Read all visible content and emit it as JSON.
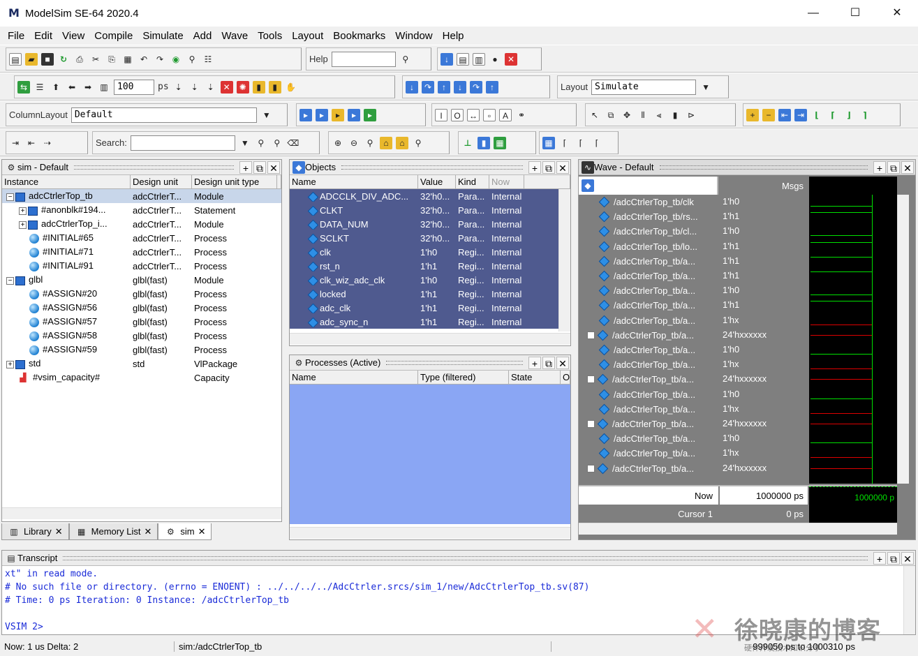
{
  "window": {
    "title": "ModelSim SE-64 2020.4",
    "logo": "M",
    "min": "—",
    "max": "☐",
    "close": "✕"
  },
  "menu": [
    "File",
    "Edit",
    "View",
    "Compile",
    "Simulate",
    "Add",
    "Wave",
    "Tools",
    "Layout",
    "Bookmarks",
    "Window",
    "Help"
  ],
  "toolbar": {
    "help_label": "Help",
    "run_length": "100",
    "run_unit": "ps",
    "layout_label": "Layout",
    "layout_value": "Simulate",
    "columnlayout_label": "ColumnLayout",
    "columnlayout_value": "Default",
    "search_label": "Search:"
  },
  "sim": {
    "title": "sim - Default",
    "columns": [
      "Instance",
      "Design unit",
      "Design unit type"
    ],
    "rows": [
      {
        "instance": "adcCtrlerTop_tb",
        "unit": "adcCtrlerT...",
        "type": "Module",
        "icon": "cube",
        "indent": 0,
        "expander": "−",
        "selected": true
      },
      {
        "instance": "#anonblk#194...",
        "unit": "adcCtrlerT...",
        "type": "Statement",
        "icon": "cube",
        "indent": 1,
        "expander": "+"
      },
      {
        "instance": "adcCtrlerTop_i...",
        "unit": "adcCtrlerT...",
        "type": "Module",
        "icon": "cube",
        "indent": 1,
        "expander": "+"
      },
      {
        "instance": "#INITIAL#65",
        "unit": "adcCtrlerT...",
        "type": "Process",
        "icon": "ball",
        "indent": 1
      },
      {
        "instance": "#INITIAL#71",
        "unit": "adcCtrlerT...",
        "type": "Process",
        "icon": "ball",
        "indent": 1
      },
      {
        "instance": "#INITIAL#91",
        "unit": "adcCtrlerT...",
        "type": "Process",
        "icon": "ball",
        "indent": 1
      },
      {
        "instance": "glbl",
        "unit": "glbl(fast)",
        "type": "Module",
        "icon": "cube",
        "indent": 0,
        "expander": "−"
      },
      {
        "instance": "#ASSIGN#20",
        "unit": "glbl(fast)",
        "type": "Process",
        "icon": "ball",
        "indent": 1
      },
      {
        "instance": "#ASSIGN#56",
        "unit": "glbl(fast)",
        "type": "Process",
        "icon": "ball",
        "indent": 1
      },
      {
        "instance": "#ASSIGN#57",
        "unit": "glbl(fast)",
        "type": "Process",
        "icon": "ball",
        "indent": 1
      },
      {
        "instance": "#ASSIGN#58",
        "unit": "glbl(fast)",
        "type": "Process",
        "icon": "ball",
        "indent": 1
      },
      {
        "instance": "#ASSIGN#59",
        "unit": "glbl(fast)",
        "type": "Process",
        "icon": "ball",
        "indent": 1
      },
      {
        "instance": "std",
        "unit": "std",
        "type": "VlPackage",
        "icon": "cube",
        "indent": 0,
        "expander": "+"
      },
      {
        "instance": "#vsim_capacity#",
        "unit": "",
        "type": "Capacity",
        "icon": "chart",
        "indent": 0
      }
    ],
    "tabs": [
      "Library",
      "Memory List",
      "sim"
    ]
  },
  "objects": {
    "title": "Objects",
    "columns": [
      "Name",
      "Value",
      "Kind"
    ],
    "now_label": "Now",
    "rows": [
      {
        "name": "ADCCLK_DIV_ADC...",
        "value": "32'h0...",
        "kind": "Para...",
        "mode": "Internal"
      },
      {
        "name": "CLKT",
        "value": "32'h0...",
        "kind": "Para...",
        "mode": "Internal"
      },
      {
        "name": "DATA_NUM",
        "value": "32'h0...",
        "kind": "Para...",
        "mode": "Internal"
      },
      {
        "name": "SCLKT",
        "value": "32'h0...",
        "kind": "Para...",
        "mode": "Internal"
      },
      {
        "name": "clk",
        "value": "1'h0",
        "kind": "Regi...",
        "mode": "Internal"
      },
      {
        "name": "rst_n",
        "value": "1'h1",
        "kind": "Regi...",
        "mode": "Internal"
      },
      {
        "name": "clk_wiz_adc_clk",
        "value": "1'h0",
        "kind": "Regi...",
        "mode": "Internal"
      },
      {
        "name": "locked",
        "value": "1'h1",
        "kind": "Regi...",
        "mode": "Internal"
      },
      {
        "name": "adc_clk",
        "value": "1'h1",
        "kind": "Regi...",
        "mode": "Internal"
      },
      {
        "name": "adc_sync_n",
        "value": "1'h1",
        "kind": "Regi...",
        "mode": "Internal"
      }
    ]
  },
  "processes": {
    "title": "Processes (Active)",
    "columns": [
      "Name",
      "Type (filtered)",
      "State",
      "O"
    ]
  },
  "wave": {
    "title": "Wave - Default",
    "msgs_label": "Msgs",
    "signals": [
      {
        "name": "/adcCtrlerTop_tb/clk",
        "value": "1'h0",
        "exp": false,
        "level": 0
      },
      {
        "name": "/adcCtrlerTop_tb/rs...",
        "value": "1'h1",
        "exp": false,
        "level": 1
      },
      {
        "name": "/adcCtrlerTop_tb/cl...",
        "value": "1'h0",
        "exp": false,
        "level": 0
      },
      {
        "name": "/adcCtrlerTop_tb/lo...",
        "value": "1'h1",
        "exp": false,
        "level": 1
      },
      {
        "name": "/adcCtrlerTop_tb/a...",
        "value": "1'h1",
        "exp": false,
        "level": 1
      },
      {
        "name": "/adcCtrlerTop_tb/a...",
        "value": "1'h1",
        "exp": false,
        "level": 1
      },
      {
        "name": "/adcCtrlerTop_tb/a...",
        "value": "1'h0",
        "exp": false,
        "level": 0
      },
      {
        "name": "/adcCtrlerTop_tb/a...",
        "value": "1'h1",
        "exp": false,
        "level": 1
      },
      {
        "name": "/adcCtrlerTop_tb/a...",
        "value": "1'hx",
        "exp": false,
        "level": 0
      },
      {
        "name": "/adcCtrlerTop_tb/a...",
        "value": "24'hxxxxxx",
        "exp": true,
        "level": 0
      },
      {
        "name": "/adcCtrlerTop_tb/a...",
        "value": "1'h0",
        "exp": false,
        "level": 0
      },
      {
        "name": "/adcCtrlerTop_tb/a...",
        "value": "1'hx",
        "exp": false,
        "level": 0
      },
      {
        "name": "/adcCtrlerTop_tb/a...",
        "value": "24'hxxxxxx",
        "exp": true,
        "level": 0
      },
      {
        "name": "/adcCtrlerTop_tb/a...",
        "value": "1'h0",
        "exp": false,
        "level": 0
      },
      {
        "name": "/adcCtrlerTop_tb/a...",
        "value": "1'hx",
        "exp": false,
        "level": 0
      },
      {
        "name": "/adcCtrlerTop_tb/a...",
        "value": "24'hxxxxxx",
        "exp": true,
        "level": 0
      },
      {
        "name": "/adcCtrlerTop_tb/a...",
        "value": "1'h0",
        "exp": false,
        "level": 0
      },
      {
        "name": "/adcCtrlerTop_tb/a...",
        "value": "1'hx",
        "exp": false,
        "level": 0
      },
      {
        "name": "/adcCtrlerTop_tb/a...",
        "value": "24'hxxxxxx",
        "exp": true,
        "level": 0
      }
    ],
    "now_label": "Now",
    "now_value": "1000000 ps",
    "cursor_label": "Cursor 1",
    "cursor_value": "0 ps",
    "time_marker": "1000000 p"
  },
  "transcript": {
    "title": "Transcript",
    "lines": [
      "xt\" in read mode.",
      "# No such file or directory. (errno = ENOENT)    : ../../../../AdcCtrler.srcs/sim_1/new/AdcCtrlerTop_tb.sv(87)",
      "#    Time: 0 ps  Iteration: 0  Instance: /adcCtrlerTop_tb",
      "",
      "VSIM 2>"
    ]
  },
  "statusbar": {
    "now": "Now: 1 us  Delta: 2",
    "path": "sim:/adcCtrlerTop_tb",
    "range": "999050 ps to 1000310 ps"
  },
  "watermark": {
    "text": "徐晓康的博客",
    "sub": "硬件开发技术知识分享"
  },
  "colors": {
    "selection_blue": "#4f5a8f",
    "processes_bg": "#8aa6f4",
    "wave_bg": "#000000",
    "wave_green": "#00e000",
    "names_bg": "#7f7f7f"
  }
}
